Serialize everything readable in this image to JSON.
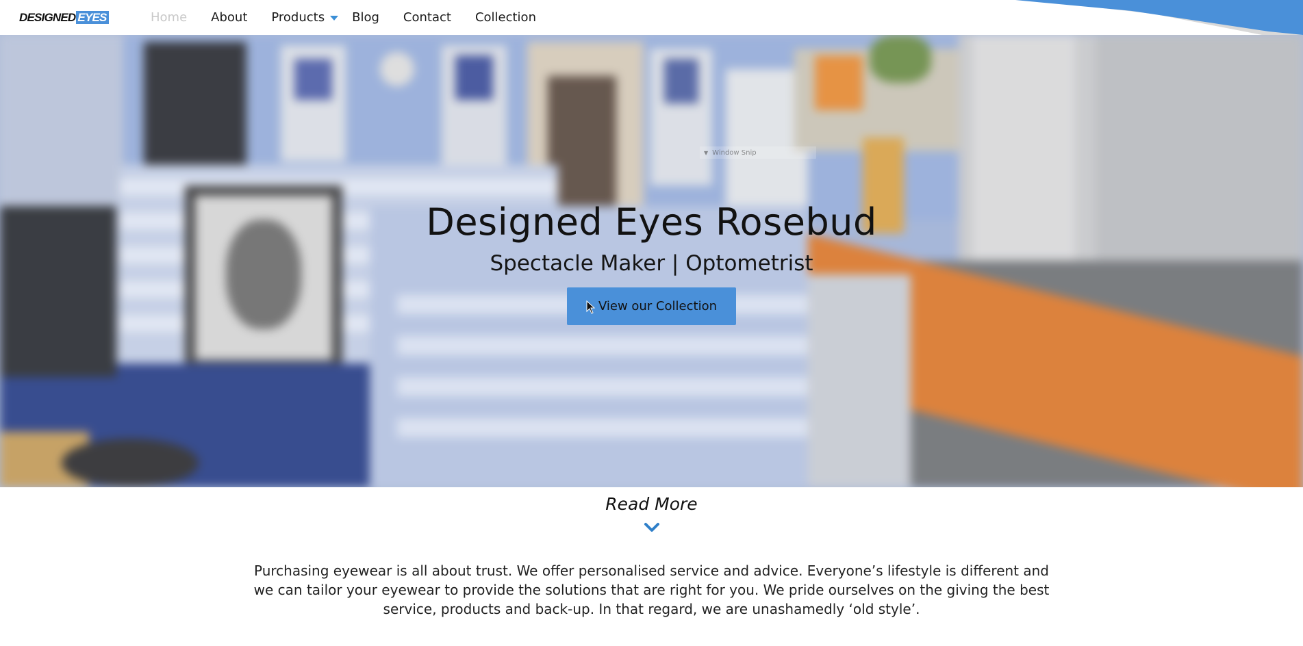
{
  "brand": {
    "logo_word_1": "DESIGNED",
    "logo_word_2": "EYES",
    "accent_color": "#4a90d9"
  },
  "nav": {
    "items": [
      {
        "label": "Home",
        "active": true
      },
      {
        "label": "About"
      },
      {
        "label": "Products",
        "has_dropdown": true,
        "icon": "caret-down-icon"
      },
      {
        "label": "Blog"
      },
      {
        "label": "Contact"
      },
      {
        "label": "Collection"
      }
    ]
  },
  "hero": {
    "title": "Designed Eyes Rosebud",
    "subtitle": "Spectacle Maker | Optometrist",
    "cta_label": "View our Collection",
    "cta_icon": "mouse-pointer-icon",
    "overlay_tooltip": "Window Snip"
  },
  "content": {
    "read_more": "Read More",
    "read_more_icon": "chevron-down-icon",
    "intro_text": "Purchasing eyewear is all about trust. We offer personalised service and advice. Everyone’s lifestyle is different and we can tailor your eyewear to provide the solutions that are right for you. We pride ourselves on the giving the best service, products and back-up. In that regard, we are unashamedly ‘old style’."
  }
}
